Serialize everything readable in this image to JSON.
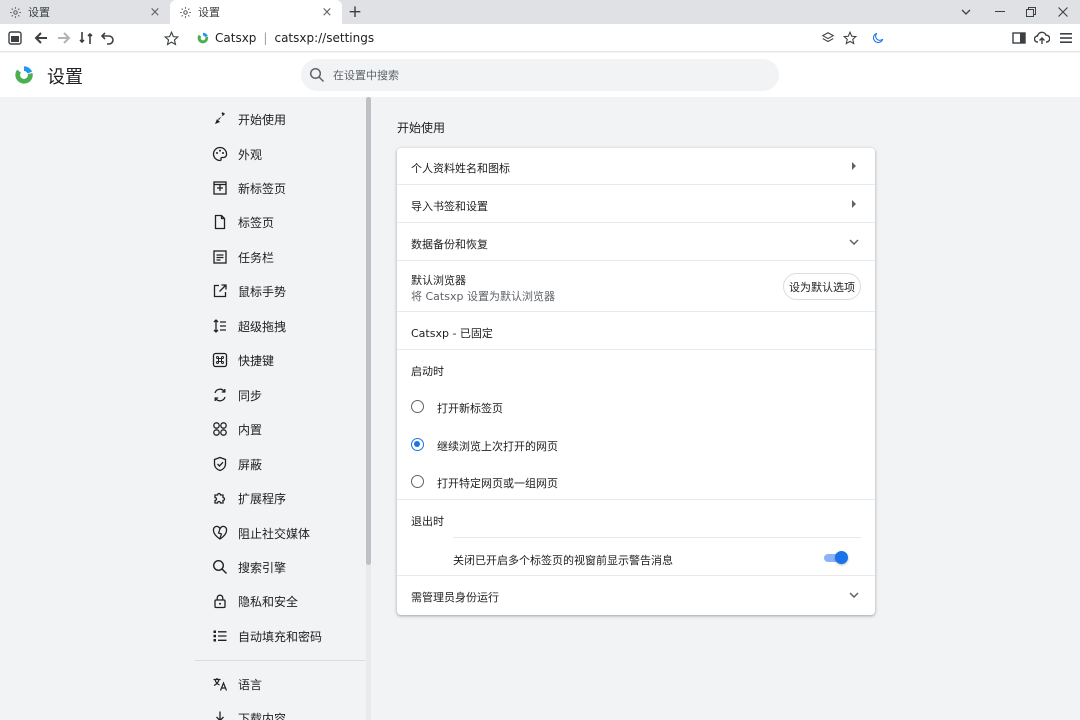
{
  "tabs": [
    {
      "title": "设置",
      "icon": "gear-icon"
    },
    {
      "title": "设置",
      "icon": "gear-icon",
      "active": true
    }
  ],
  "toolbar": {
    "site_name": "Catsxp",
    "separator": "|",
    "url": "catsxp://settings"
  },
  "header": {
    "title": "设置",
    "search_placeholder": "在设置中搜索"
  },
  "sidebar": {
    "items": [
      {
        "label": "开始使用",
        "icon": "rocket-icon",
        "active": true
      },
      {
        "label": "外观",
        "icon": "palette-icon"
      },
      {
        "label": "新标签页",
        "icon": "new-tab-icon"
      },
      {
        "label": "标签页",
        "icon": "document-icon"
      },
      {
        "label": "任务栏",
        "icon": "taskbar-icon"
      },
      {
        "label": "鼠标手势",
        "icon": "external-link-icon"
      },
      {
        "label": "超级拖拽",
        "icon": "drag-list-icon"
      },
      {
        "label": "快捷键",
        "icon": "command-key-icon"
      },
      {
        "label": "同步",
        "icon": "sync-icon"
      },
      {
        "label": "内置",
        "icon": "grid-icon"
      },
      {
        "label": "屏蔽",
        "icon": "shield-icon"
      },
      {
        "label": "扩展程序",
        "icon": "puzzle-icon"
      },
      {
        "label": "阻止社交媒体",
        "icon": "heart-block-icon"
      },
      {
        "label": "搜索引擎",
        "icon": "search-icon"
      },
      {
        "label": "隐私和安全",
        "icon": "lock-icon"
      },
      {
        "label": "自动填充和密码",
        "icon": "list-icon"
      },
      {
        "label": "语言",
        "icon": "translate-icon"
      },
      {
        "label": "下载内容",
        "icon": "download-icon"
      }
    ]
  },
  "main": {
    "section_title": "开始使用",
    "rows": {
      "profile": "个人资料姓名和图标",
      "import": "导入书签和设置",
      "backup": "数据备份和恢复",
      "default_browser": "默认浏览器",
      "default_browser_sub": "将 Catsxp 设置为默认浏览器",
      "default_button": "设为默认选项",
      "pinned": "Catsxp - 已固定",
      "startup": "启动时",
      "exit": "退出时",
      "admin": "需管理员身份运行"
    },
    "startup_options": [
      {
        "label": "打开新标签页",
        "selected": false
      },
      {
        "label": "继续浏览上次打开的网页",
        "selected": true
      },
      {
        "label": "打开特定网页或一组网页",
        "selected": false
      }
    ],
    "exit_toggle": {
      "label": "关闭已开启多个标签页的视窗前显示警告消息",
      "enabled": true
    }
  },
  "colors": {
    "accent": "#1a73e8",
    "brand_green": "#4caf50",
    "brand_blue": "#2196f3"
  }
}
